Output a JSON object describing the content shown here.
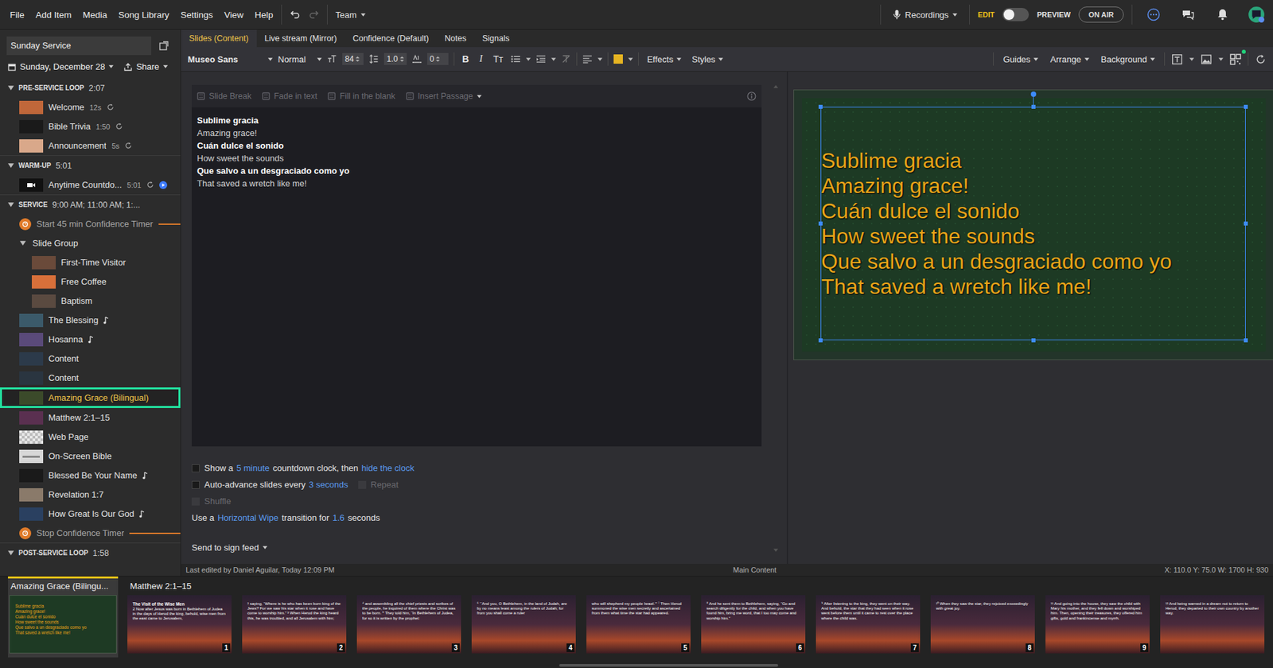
{
  "menu": [
    "File",
    "Add Item",
    "Media",
    "Song Library",
    "Settings",
    "View",
    "Help"
  ],
  "team": "Team",
  "topbar": {
    "recordings": "Recordings",
    "edit": "EDIT",
    "preview_label": "PREVIEW",
    "preview_on": false,
    "on_air": "ON AIR"
  },
  "sidebar": {
    "service_name": "Sunday Service",
    "date": "Sunday, December 28",
    "share": "Share",
    "sections": [
      {
        "title": "PRE-SERVICE LOOP",
        "duration": "2:07",
        "expanded": true,
        "items": [
          {
            "kind": "media",
            "label": "Welcome",
            "color": "#c0673a",
            "selected": false,
            "duration": "12s",
            "loop": true,
            "playing": false
          },
          {
            "kind": "media",
            "label": "Bible Trivia",
            "color": "#1a1a1a",
            "selected": false,
            "duration": "1:50",
            "loop": true,
            "playing": false
          },
          {
            "kind": "media",
            "label": "Announcement",
            "color": "#d9a88a",
            "selected": false,
            "duration": "5s",
            "loop": true,
            "playing": false
          }
        ]
      },
      {
        "title": "WARM-UP",
        "duration": "5:01",
        "expanded": true,
        "items": [
          {
            "kind": "video",
            "label": "Anytime Countdo...",
            "color": "#111111",
            "selected": false,
            "duration": "5:01",
            "loop": true,
            "playing": true
          }
        ]
      },
      {
        "title": "SERVICE",
        "duration": "9:00 AM; 11:00 AM; 1:...",
        "expanded": true,
        "items": [
          {
            "kind": "timer",
            "label": "Start 45 min Confidence Timer",
            "color": "#e07b2a",
            "selected": false,
            "duration": "",
            "loop": false,
            "playing": false
          },
          {
            "kind": "group",
            "label": "Slide Group",
            "color": "#2b2b2b",
            "selected": false,
            "duration": "",
            "loop": false,
            "playing": false,
            "expanded": true,
            "children": [
              {
                "kind": "media",
                "label": "First-Time Visitor",
                "color": "#6a4a3a",
                "selected": false,
                "duration": "",
                "loop": false,
                "playing": false
              },
              {
                "kind": "media",
                "label": "Free Coffee",
                "color": "#d8703a",
                "selected": false,
                "duration": "",
                "loop": false,
                "playing": false
              },
              {
                "kind": "media",
                "label": "Baptism",
                "color": "#5a4a40",
                "selected": false,
                "duration": "",
                "loop": false,
                "playing": false
              }
            ]
          },
          {
            "kind": "song",
            "label": "The Blessing",
            "color": "#3b5a6a",
            "selected": false,
            "duration": "",
            "loop": false,
            "playing": false
          },
          {
            "kind": "song",
            "label": "Hosanna",
            "color": "#5a4a7a",
            "selected": false,
            "duration": "",
            "loop": false,
            "playing": false
          },
          {
            "kind": "media",
            "label": "Content",
            "color": "#2c3a4a",
            "selected": false,
            "duration": "",
            "loop": false,
            "playing": false
          },
          {
            "kind": "media",
            "label": "Content",
            "color": "#2a3540",
            "selected": false,
            "duration": "",
            "loop": false,
            "playing": false
          },
          {
            "kind": "media",
            "label": "Amazing Grace (Bilingual)",
            "color": "#3b4a2a",
            "selected": true,
            "duration": "",
            "loop": false,
            "playing": false
          },
          {
            "kind": "media",
            "label": "Matthew 2:1–15",
            "color": "#5a3050",
            "selected": false,
            "duration": "",
            "loop": false,
            "playing": false
          },
          {
            "kind": "web",
            "label": "Web Page",
            "color": "#e8e8e8",
            "selected": false,
            "duration": "",
            "loop": false,
            "playing": false
          },
          {
            "kind": "bible",
            "label": "On-Screen Bible",
            "color": "#d8d8d8",
            "selected": false,
            "duration": "",
            "loop": false,
            "playing": false
          },
          {
            "kind": "song",
            "label": "Blessed Be Your Name",
            "color": "#1a1a1a",
            "selected": false,
            "duration": "",
            "loop": false,
            "playing": false
          },
          {
            "kind": "media",
            "label": "Revelation 1:7",
            "color": "#8a7a6a",
            "selected": false,
            "duration": "",
            "loop": false,
            "playing": false
          },
          {
            "kind": "song",
            "label": "How Great Is Our God",
            "color": "#2a4060",
            "selected": false,
            "duration": "",
            "loop": false,
            "playing": false
          },
          {
            "kind": "timer",
            "label": "Stop Confidence Timer",
            "color": "#e07b2a",
            "selected": false,
            "duration": "",
            "loop": false,
            "playing": false
          }
        ]
      },
      {
        "title": "POST-SERVICE LOOP",
        "duration": "1:58",
        "expanded": true,
        "items": []
      }
    ]
  },
  "tabs": [
    {
      "label": "Slides (Content)",
      "selected": true
    },
    {
      "label": "Live stream (Mirror)",
      "selected": false
    },
    {
      "label": "Confidence (Default)",
      "selected": false
    },
    {
      "label": "Notes",
      "selected": false
    },
    {
      "label": "Signals",
      "selected": false
    }
  ],
  "toolbar": {
    "font": "Museo Sans",
    "weight": "Normal",
    "size": "84",
    "line_height": "1.0",
    "spacing": "0",
    "format": [
      "B",
      "I",
      "Tт"
    ],
    "fill_color": "#e6b422",
    "menus_left": [
      "Effects",
      "Styles"
    ],
    "menus_right": [
      "Guides",
      "Arrange",
      "Background"
    ]
  },
  "editor": {
    "tools": [
      {
        "label": "Slide Break",
        "disabled": true
      },
      {
        "label": "Fade in text",
        "disabled": true
      },
      {
        "label": "Fill in the blank",
        "disabled": true
      },
      {
        "label": "Insert Passage",
        "disabled": true
      }
    ],
    "lines": [
      {
        "text": "Sublime gracia",
        "bold": true
      },
      {
        "text": "Amazing grace!",
        "bold": false
      },
      {
        "text": "Cuán dulce el sonido",
        "bold": true
      },
      {
        "text": "How sweet the sounds",
        "bold": false
      },
      {
        "text": "Que salvo a un desgraciado como yo",
        "bold": true
      },
      {
        "text": "That saved a wretch like me!",
        "bold": false
      }
    ]
  },
  "options": {
    "countdown": {
      "checked": false,
      "prefix": "Show a",
      "duration": "5 minute",
      "middle": "countdown clock, then",
      "action": "hide the clock"
    },
    "advance": {
      "checked": false,
      "prefix": "Auto-advance slides every",
      "interval": "3 seconds"
    },
    "repeat": {
      "label": "Repeat",
      "checked": false,
      "disabled": true
    },
    "shuffle": {
      "label": "Shuffle",
      "checked": false,
      "disabled": true
    },
    "transition": {
      "prefix": "Use a",
      "name": "Horizontal Wipe",
      "middle": "transition for",
      "duration": "1.6",
      "suffix": "seconds"
    },
    "sign_feed": "Send to sign feed"
  },
  "preview": {
    "color": "#e8a419",
    "lines": [
      "Sublime gracia",
      "Amazing grace!",
      "Cuán dulce el sonido",
      "How sweet the sounds",
      "Que salvo a un desgraciado como yo",
      "That saved a wretch like me!"
    ]
  },
  "status": {
    "edited": "Last edited by Daniel Aguilar, Today 12:09 PM",
    "layer": "Main Content",
    "geometry": "X: 110.0 Y: 75.0 W: 1700 H: 930"
  },
  "filmstrip": [
    {
      "label": "Amazing Grace (Bilingu...",
      "selected": true,
      "slides": [
        {
          "kind": "lyrics",
          "title": "",
          "body": "",
          "lines": [
            "Sublime gracia",
            "Amazing grace!",
            "Cuán dulce el sonido",
            "How sweet the sounds",
            "Que salvo a un desgraciado como yo",
            "That saved a wretch like me!"
          ],
          "number": ""
        }
      ]
    },
    {
      "label": "Matthew 2:1–15",
      "selected": false,
      "slides": [
        {
          "kind": "passage",
          "title": "The Visit of the Wise Men",
          "body": "2 Now after Jesus was born in Bethlehem of Judea in the days of Herod the king, behold, wise men from the east came to Jerusalem,",
          "lines": [],
          "number": "1"
        },
        {
          "kind": "passage",
          "title": "",
          "body": "² saying, “Where is he who has been born king of the Jews? For we saw his star when it rose and have come to worship him.” ³ When Herod the king heard this, he was troubled, and all Jerusalem with him;",
          "lines": [],
          "number": "2"
        },
        {
          "kind": "passage",
          "title": "",
          "body": "⁴ and assembling all the chief priests and scribes of the people, he inquired of them where the Christ was to be born. ⁵ They told him, “In Bethlehem of Judea, for so it is written by the prophet:",
          "lines": [],
          "number": "3"
        },
        {
          "kind": "passage",
          "title": "",
          "body": "⁶ “‘And you, O Bethlehem, in the land of Judah, are by no means least among the rulers of Judah; for from you shall come a ruler",
          "lines": [],
          "number": "4"
        },
        {
          "kind": "passage",
          "title": "",
          "body": "who will shepherd my people Israel.’” ⁷ Then Herod summoned the wise men secretly and ascertained from them what time the star had appeared.",
          "lines": [],
          "number": "5"
        },
        {
          "kind": "passage",
          "title": "",
          "body": "⁸ And he sent them to Bethlehem, saying, “Go and search diligently for the child, and when you have found him, bring me word, that I too may come and worship him.”",
          "lines": [],
          "number": "6"
        },
        {
          "kind": "passage",
          "title": "",
          "body": "⁹ After listening to the king, they went on their way. And behold, the star that they had seen when it rose went before them until it came to rest over the place where the child was.",
          "lines": [],
          "number": "7"
        },
        {
          "kind": "passage",
          "title": "",
          "body": "¹⁰ When they saw the star, they rejoiced exceedingly with great joy.",
          "lines": [],
          "number": "8"
        },
        {
          "kind": "passage",
          "title": "",
          "body": "¹¹ And going into the house, they saw the child with Mary his mother, and they fell down and worshiped him. Then, opening their treasures, they offered him gifts, gold and frankincense and myrrh.",
          "lines": [],
          "number": "9"
        },
        {
          "kind": "passage",
          "title": "",
          "body": "¹² And being warned in a dream not to return to Herod, they departed to their own country by another way.",
          "lines": [],
          "number": ""
        }
      ]
    }
  ]
}
